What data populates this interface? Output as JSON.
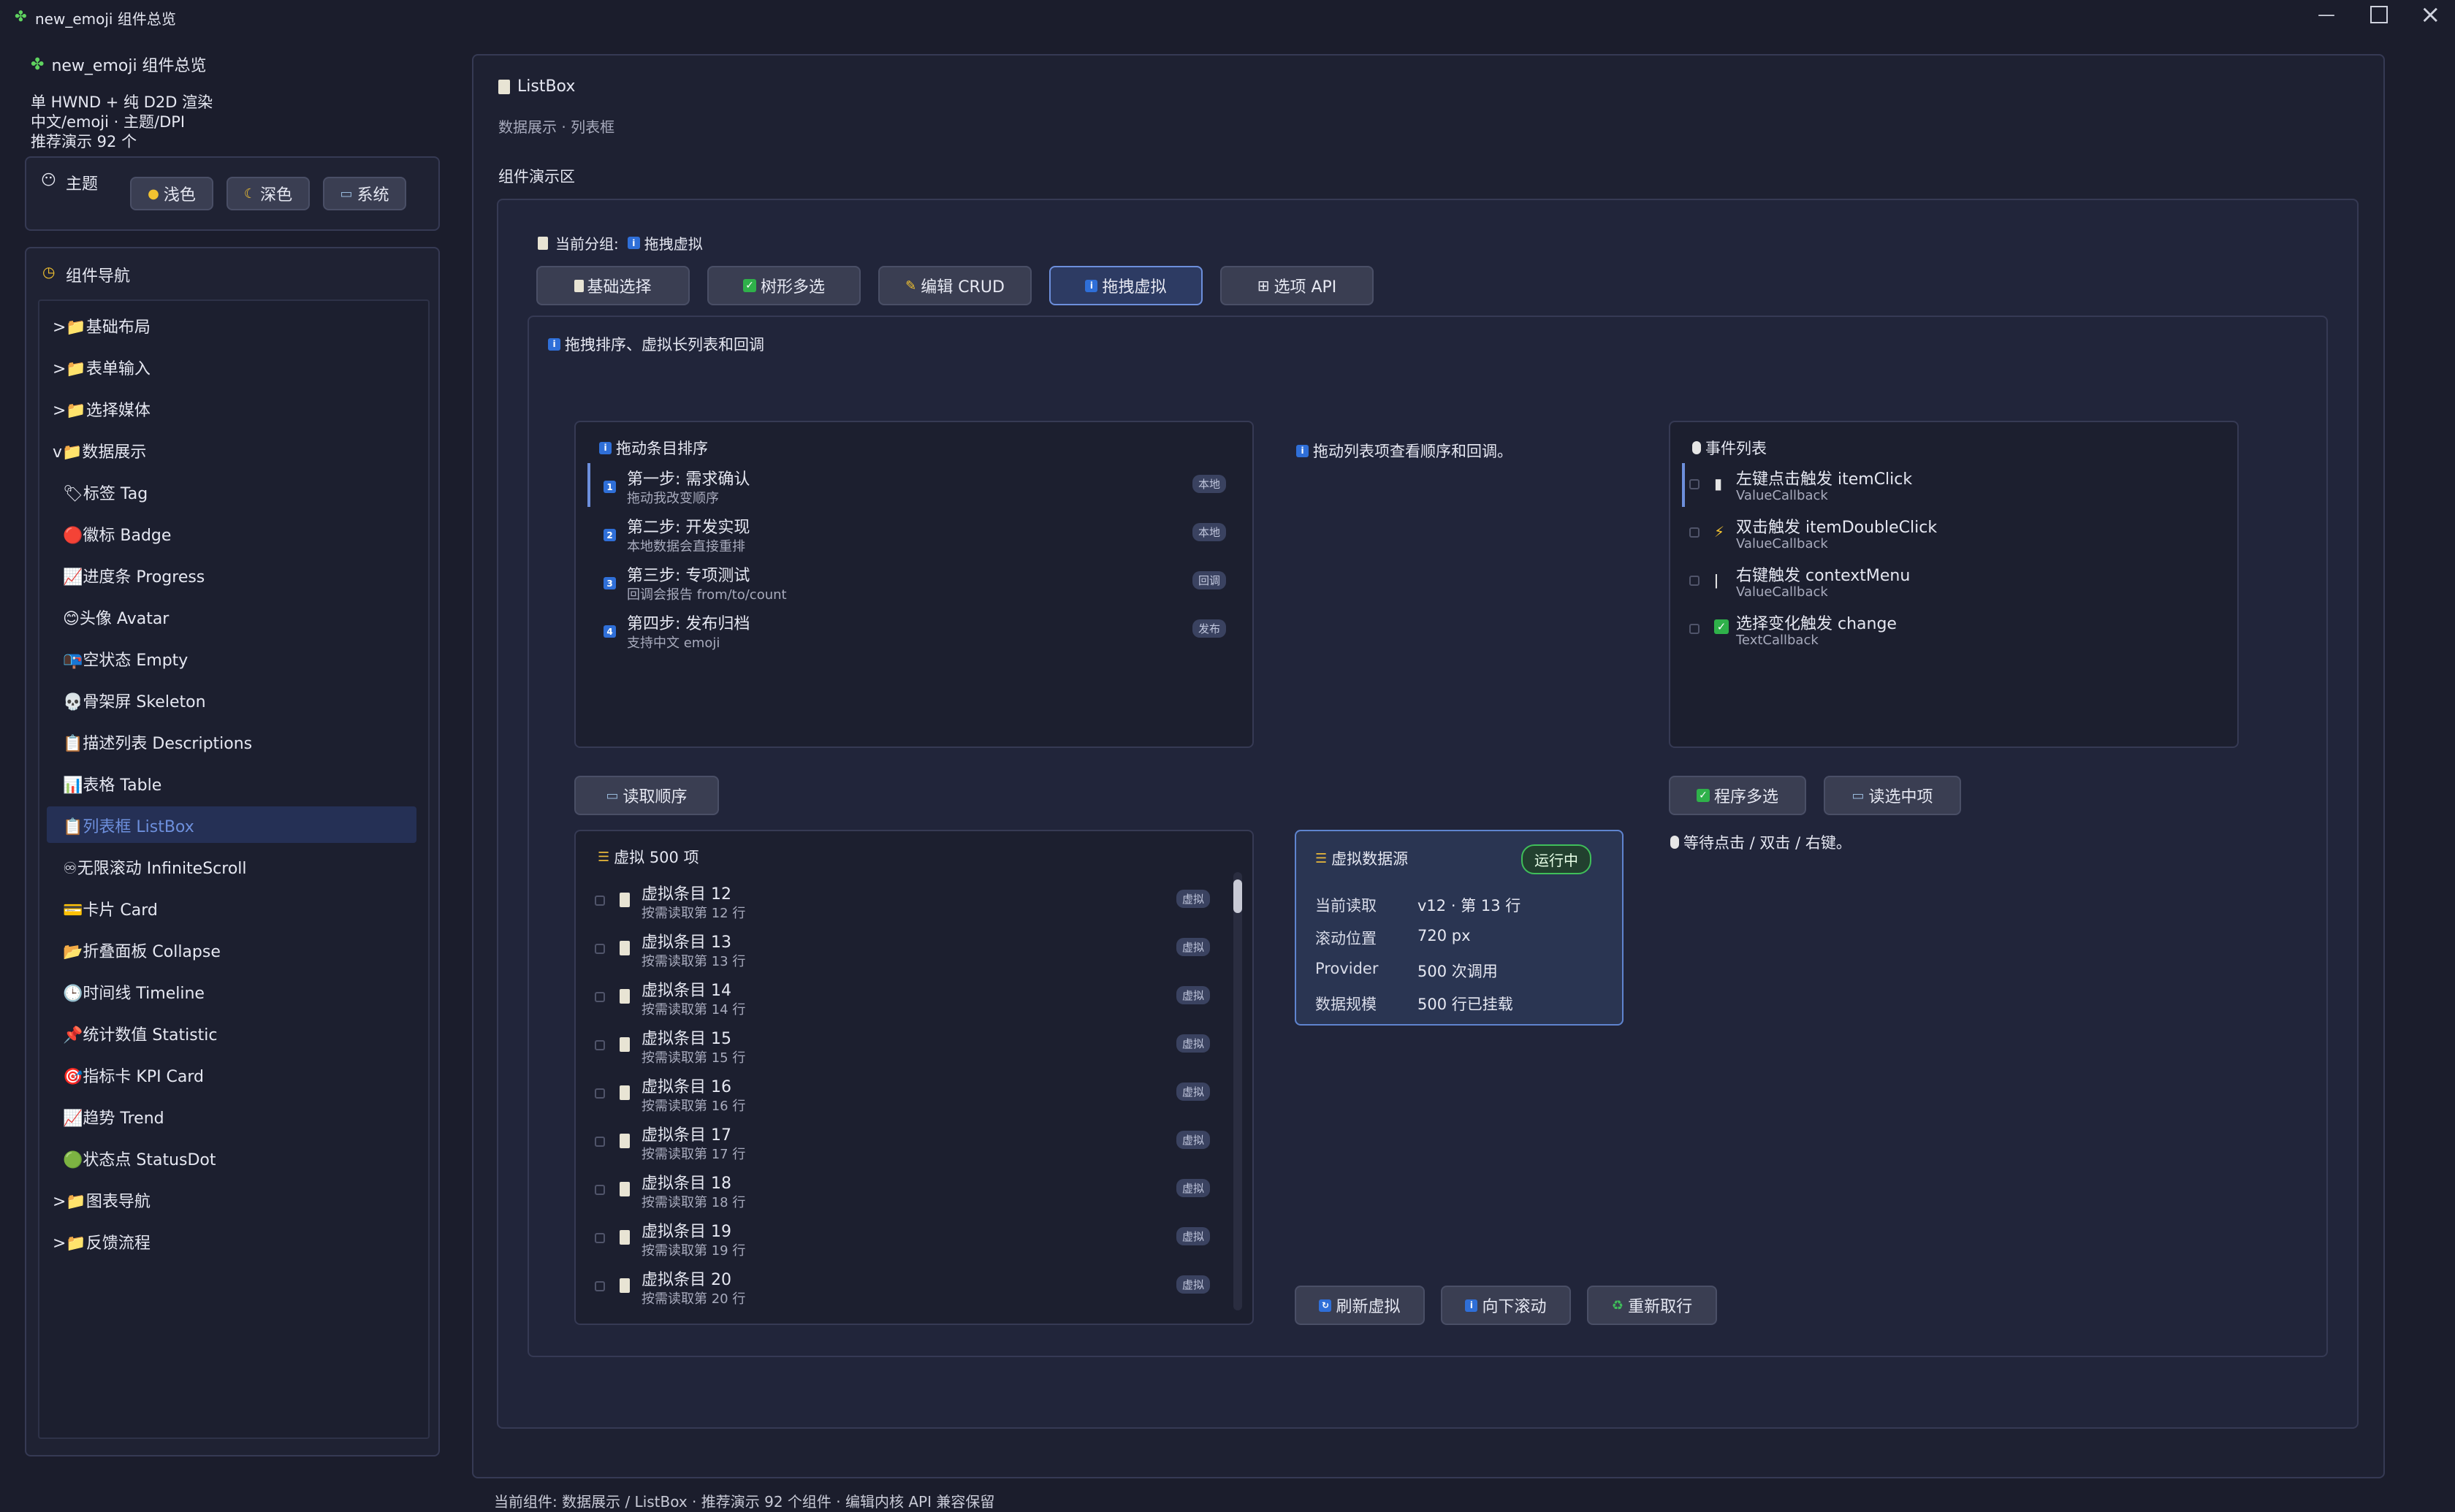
{
  "window": {
    "title": "new_emoji 组件总览",
    "controls": [
      "minimize",
      "maximize",
      "close"
    ]
  },
  "sidebar": {
    "app_title": "new_emoji 组件总览",
    "info_lines": [
      "单 HWND + 纯 D2D 渲染",
      "中文/emoji · 主题/DPI",
      "推荐演示 92 个"
    ],
    "theme": {
      "label": "主题",
      "buttons": [
        {
          "label": "浅色",
          "icon": "sun-icon"
        },
        {
          "label": "深色",
          "icon": "moon-icon"
        },
        {
          "label": "系统",
          "icon": "computer-icon"
        }
      ]
    },
    "nav": {
      "title": "组件导航",
      "items": [
        {
          "label": ">📁基础布局"
        },
        {
          "label": ">📁表单输入"
        },
        {
          "label": ">📁选择媒体"
        },
        {
          "label": "v📁数据展示"
        },
        {
          "label": "🏷标签 Tag"
        },
        {
          "label": "🔴徽标 Badge"
        },
        {
          "label": "📈进度条 Progress"
        },
        {
          "label": "😊头像 Avatar"
        },
        {
          "label": "📭空状态 Empty"
        },
        {
          "label": "💀骨架屏 Skeleton"
        },
        {
          "label": "📋描述列表 Descriptions"
        },
        {
          "label": "📊表格 Table"
        },
        {
          "label": "📋列表框 ListBox"
        },
        {
          "label": "♾无限滚动 InfiniteScroll"
        },
        {
          "label": "💳卡片 Card"
        },
        {
          "label": "📂折叠面板 Collapse"
        },
        {
          "label": "🕒时间线 Timeline"
        },
        {
          "label": "📌统计数值 Statistic"
        },
        {
          "label": "🎯指标卡 KPI Card"
        },
        {
          "label": "📈趋势 Trend"
        },
        {
          "label": "🟢状态点 StatusDot"
        },
        {
          "label": ">📁图表导航"
        },
        {
          "label": ">📁反馈流程"
        }
      ],
      "selected_index": 12
    }
  },
  "main": {
    "title": "ListBox",
    "breadcrumb": "数据展示 · 列表框",
    "demo_label": "组件演示区",
    "current_group_label": "当前分组:",
    "current_group_value": "拖拽虚拟",
    "tabs": [
      {
        "label": "基础选择"
      },
      {
        "label": "树形多选"
      },
      {
        "label": "编辑 CRUD"
      },
      {
        "label": "拖拽虚拟"
      },
      {
        "label": "选项 API"
      }
    ],
    "active_tab": 3,
    "section_title": "拖拽排序、虚拟长列表和回调",
    "sortable": {
      "title": "拖动条目排序",
      "items": [
        {
          "num": "1",
          "title": "第一步: 需求确认",
          "desc": "拖动我改变顺序",
          "tag": "本地"
        },
        {
          "num": "2",
          "title": "第二步: 开发实现",
          "desc": "本地数据会直接重排",
          "tag": "本地"
        },
        {
          "num": "3",
          "title": "第三步: 专项测试",
          "desc": "回调会报告 from/to/count",
          "tag": "回调"
        },
        {
          "num": "4",
          "title": "第四步: 发布归档",
          "desc": "支持中文 emoji",
          "tag": "发布"
        }
      ],
      "read_button": "读取顺序"
    },
    "drag_hint": "拖动列表项查看顺序和回调。",
    "events": {
      "title": "事件列表",
      "items": [
        {
          "title": "左键点击触发 itemClick",
          "desc": "ValueCallback"
        },
        {
          "title": "双击触发 itemDoubleClick",
          "desc": "ValueCallback"
        },
        {
          "title": "右键触发 contextMenu",
          "desc": "ValueCallback"
        },
        {
          "title": "选择变化触发 change",
          "desc": "TextCallback"
        }
      ],
      "multi_select_button": "程序多选",
      "read_selected_button": "读选中项",
      "status": "等待点击 / 双击 / 右键。"
    },
    "virtual": {
      "title": "虚拟 500 项",
      "items": [
        {
          "title": "虚拟条目 12",
          "desc": "按需读取第 12 行",
          "tag": "虚拟"
        },
        {
          "title": "虚拟条目 13",
          "desc": "按需读取第 13 行",
          "tag": "虚拟"
        },
        {
          "title": "虚拟条目 14",
          "desc": "按需读取第 14 行",
          "tag": "虚拟"
        },
        {
          "title": "虚拟条目 15",
          "desc": "按需读取第 15 行",
          "tag": "虚拟"
        },
        {
          "title": "虚拟条目 16",
          "desc": "按需读取第 16 行",
          "tag": "虚拟"
        },
        {
          "title": "虚拟条目 17",
          "desc": "按需读取第 17 行",
          "tag": "虚拟"
        },
        {
          "title": "虚拟条目 18",
          "desc": "按需读取第 18 行",
          "tag": "虚拟"
        },
        {
          "title": "虚拟条目 19",
          "desc": "按需读取第 19 行",
          "tag": "虚拟"
        },
        {
          "title": "虚拟条目 20",
          "desc": "按需读取第 20 行",
          "tag": "虚拟"
        }
      ]
    },
    "datasource": {
      "title": "虚拟数据源",
      "status": "运行中",
      "rows": [
        {
          "key": "当前读取",
          "value": "v12 · 第 13 行"
        },
        {
          "key": "滚动位置",
          "value": "720 px"
        },
        {
          "key": "Provider",
          "value": "500 次调用"
        },
        {
          "key": "数据规模",
          "value": "500 行已挂载"
        }
      ]
    },
    "bottom_buttons": [
      {
        "label": "刷新虚拟"
      },
      {
        "label": "向下滚动"
      },
      {
        "label": "重新取行"
      }
    ]
  },
  "statusbar": {
    "text": "当前组件: 数据展示 / ListBox · 推荐演示 92 个组件 · 编辑内核 API 兼容保留"
  },
  "colors": {
    "background": "#1b1d2c",
    "panel": "#1f2233",
    "accent": "#2f6fd8",
    "selected": "#253055",
    "success": "#2fb14a"
  }
}
